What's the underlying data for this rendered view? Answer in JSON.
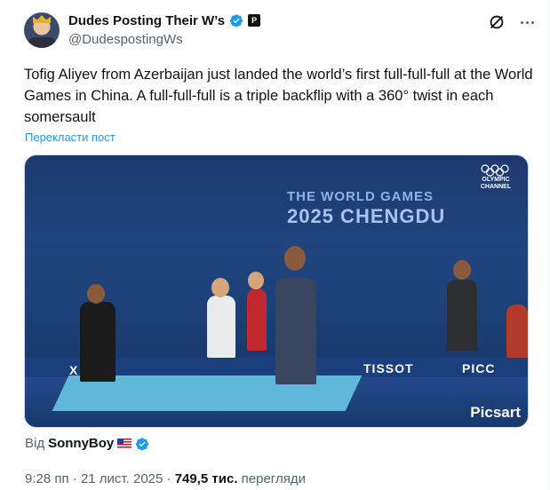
{
  "author": {
    "display_name": "Dudes Posting Their W’s",
    "handle": "@DudespostingWs",
    "affiliation_badge": "P"
  },
  "icons": {
    "verified": "verified-badge-icon",
    "grok": "grok-icon",
    "more": "more-options-icon"
  },
  "tweet": {
    "text": "Tofig Aliyev from Azerbaijan just landed the world’s first full-full-full at the World Games in China. A full-full-full is a triple backflip with a 360° twist in each somersault",
    "translate_link": "Перекласти пост"
  },
  "media": {
    "event_title": "THE WORLD GAMES",
    "event_subtitle": "2025 CHENGDU",
    "channel": "OLYMPIC CHANNEL",
    "sponsor_1": "X 特步",
    "sponsor_2": "TISSOT",
    "sponsor_3": "PICC",
    "watermark": "Picsart"
  },
  "via": {
    "prefix": "Від",
    "source_name": "SonnyBoy"
  },
  "meta": {
    "time": "9:28 пп",
    "separator": "·",
    "date": "21 лист. 2025",
    "views_count": "749,5 тис.",
    "views_label": "перегляди"
  },
  "colors": {
    "accent": "#1d9bf0",
    "secondary_text": "#536471",
    "primary_text": "#0f1419"
  }
}
